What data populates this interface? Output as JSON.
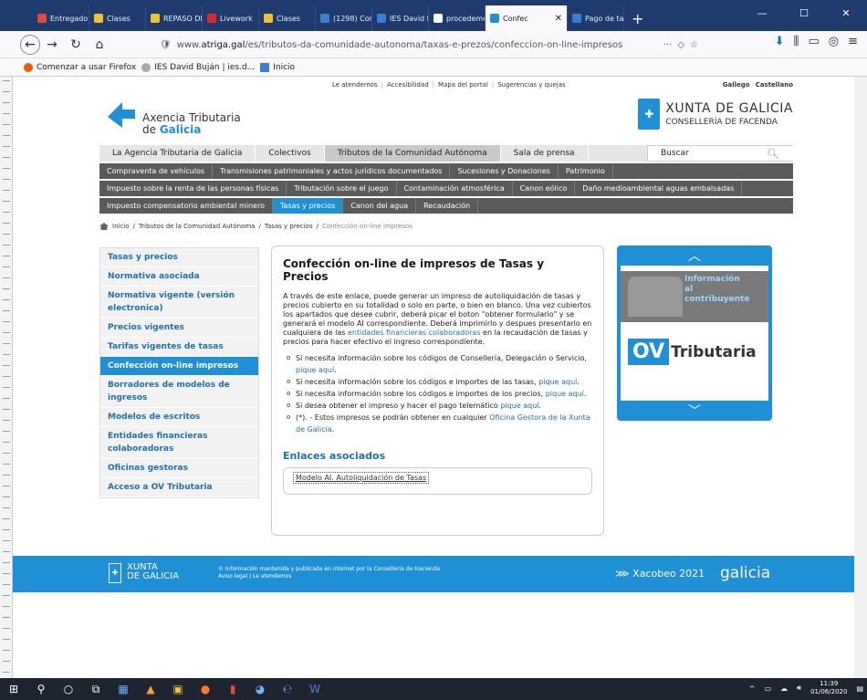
{
  "browser": {
    "tabs": [
      {
        "label": "Entregado",
        "color": "#e24a3d"
      },
      {
        "label": "Clases",
        "color": "#f2c12e"
      },
      {
        "label": "REPASO DE",
        "color": "#f2c12e"
      },
      {
        "label": "Livework",
        "color": "#d62b2b"
      },
      {
        "label": "Clases",
        "color": "#f2c12e"
      },
      {
        "label": "(1298) Con",
        "color": "#3a7fd5"
      },
      {
        "label": "IES David B",
        "color": "#3a7fd5"
      },
      {
        "label": "procedemento",
        "color": "#ffffff"
      },
      {
        "label": "Confec",
        "color": "#1f8fd6",
        "active": true
      },
      {
        "label": "Pago de ta",
        "color": "#3a7fd5"
      }
    ],
    "url_prefix": "www.",
    "url_host": "atriga.gal",
    "url_path": "/es/tributos-da-comunidade-autonoma/taxas-e-prezos/confeccion-on-line-impresos",
    "bookmarks": [
      "Comenzar a usar Firefox",
      "IES David Buján | ies.d...",
      "Inicio"
    ]
  },
  "site": {
    "top_links": [
      "Le atendemos",
      "Accesibilidad",
      "Mapa del portal",
      "Sugerencias y quejas"
    ],
    "langs": [
      "Gallego",
      "Castellano"
    ],
    "logo_line1": "Axencia Tributaria",
    "logo_line2_prefix": "de ",
    "logo_line2_brand": "Galicia",
    "xunta_name": "XUNTA DE GALICIA",
    "xunta_dept": "CONSELLERÍA DE FACENDA",
    "main_menu": [
      "La Agencia Tributaria de Galicia",
      "Colectivos",
      "Tributos de la Comunidad Autónoma",
      "Sala de prensa"
    ],
    "search_placeholder": "Buscar",
    "sub_row1": [
      "Compraventa de vehículos",
      "Transmisiones patrimoniales y actos jurídicos documentados",
      "Sucesiones y Donaciones",
      "Patrimonio"
    ],
    "sub_row2": [
      "Impuesto sobre la renta de las personas físicas",
      "Tributación sobre el juego",
      "Contaminación atmosférica",
      "Canon eólico",
      "Daño medioambiental aguas embalsadas"
    ],
    "sub_row3": [
      "Impuesto compensatorio ambiental minero",
      "Tasas y precios",
      "Canon del agua",
      "Recaudación"
    ],
    "breadcrumb": [
      "Inicio",
      "Tributos de la Comunidad Autónoma",
      "Tasas y precios",
      "Confección on-line impresos"
    ],
    "sidebar": [
      "Tasas y precios",
      "Normativa asociada",
      "Normativa vigente (versión electronica)",
      "Precios vigentes",
      "Tarifas vigentes de tasas",
      "Confección on-line impresos",
      "Borradores de modelos de ingresos",
      "Modelos de escritos",
      "Entidades financieras colaboradoras",
      "Oficinas gestoras",
      "Acceso a OV Tributaria"
    ],
    "content": {
      "title": "Confección on-line de impresos de Tasas y Precios",
      "intro_a": "A través de este enlace,  puede generar un impreso de autoliquidación de tasas y precios cubierto en su totalidad o solo en parte, o bien en blanco. Una vez cubiertos los apartados que desee cubrir, deberá picar el boton \"obtener formulario\" y se generará el modelo AI correspondiente. Deberá imprimirlo y despues presentarlo en cualquiera de las ",
      "intro_link": "entidades financieras colaboradoras",
      "intro_b": " en la recaudación de tasas y precios para hacer efectivo el ingreso correspondiente.",
      "bullets": [
        {
          "text": "Si necesita información sobre los códigos de Consellería, Delegación o Servicio, ",
          "link": "pique aquí",
          "after": "."
        },
        {
          "text": "Si necesita información sobre los códigos e importes de las tasas, ",
          "link": "pique aquí",
          "after": "."
        },
        {
          "text": "Si necesita información sobre los códigos e importes de los precios, ",
          "link": "pique aquí",
          "after": "."
        },
        {
          "text": "Si desea obtener el impreso y hacer el pago telemático  ",
          "link": "pique aquí",
          "after": "."
        },
        {
          "text": "(*). - Estos impresos se podrán obtener en cualquier ",
          "link": "Oficina Gestora de la Xunta de Galicia",
          "after": "."
        }
      ],
      "assoc_title": "Enlaces asociados",
      "assoc_link": "Modelo AI. Autoliquidación de Tasas"
    },
    "rightbox": {
      "info": [
        "Información",
        "al",
        "contribuyente"
      ],
      "ov": "OV",
      "tributaria": "Tributaria"
    },
    "footer": {
      "xunta": [
        "XUNTA",
        "DE GALICIA"
      ],
      "line1": "© Información mantenida y publicada en internet por la Consellería de Hacienda",
      "line2": "Aviso legal  |  Le atendemos",
      "xacobeo": "Xacobeo 2021",
      "galicia": "galicia"
    }
  },
  "taskbar": {
    "time": "11:39",
    "date": "01/06/2020"
  }
}
